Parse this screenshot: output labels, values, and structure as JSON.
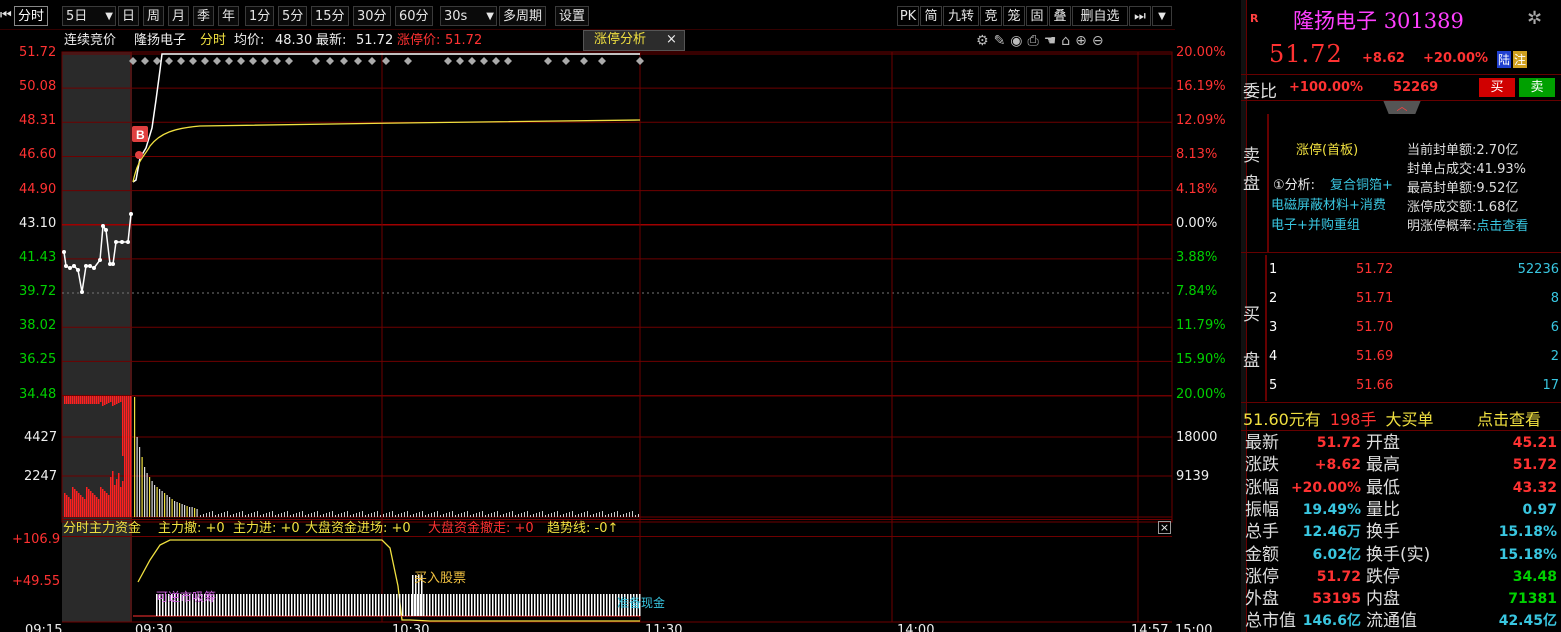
{
  "toolbar": {
    "left": [
      "分时",
      "5日",
      "日",
      "周",
      "月",
      "季",
      "年",
      "1分",
      "5分",
      "15分",
      "30分",
      "60分",
      "30s",
      "多周期",
      "设置"
    ],
    "right": [
      "PK",
      "简",
      "九转",
      "竞",
      "笼",
      "固",
      "叠",
      "删自选"
    ]
  },
  "chart": {
    "info": {
      "auction": "连续竞价",
      "name": "隆扬电子",
      "mode": "分时",
      "avg_label": "均价:",
      "avg": "48.30",
      "latest_label": "最新:",
      "latest": "51.72",
      "limit_label": "涨停价:",
      "limit": "51.72"
    },
    "tab": "涨停分析",
    "price_ticks": [
      "51.72",
      "50.08",
      "48.31",
      "46.60",
      "44.90",
      "43.10",
      "41.43",
      "39.72",
      "38.02",
      "36.25",
      "34.48"
    ],
    "pct_ticks": [
      "20.00%",
      "16.19%",
      "12.09%",
      "8.13%",
      "4.18%",
      "0.00%",
      "3.88%",
      "7.84%",
      "11.79%",
      "15.90%",
      "20.00%"
    ],
    "vol_ticks_left": [
      "4427",
      "2247"
    ],
    "vol_ticks_right": [
      "18000",
      "9139"
    ],
    "time_ticks": [
      "09:15",
      "09:30",
      "10:30",
      "11:30",
      "14:00",
      "14:57",
      "15:00"
    ],
    "buy_marker": "B",
    "fund": {
      "title": "分时主力资金",
      "items": [
        "主力撤: +0",
        "主力进: +0",
        "大盘资金进场: +0",
        "大盘资金撤走: +0",
        "趋势线: -0↑"
      ],
      "ticks": [
        "+106.9",
        "+49.55"
      ],
      "buy_label": "买入股票",
      "bottom_labels": [
        "可逆市吸筹",
        "准备现金"
      ]
    }
  },
  "quote": {
    "code_label": "R",
    "name": "隆扬电子",
    "code": "301389",
    "price": "51.72",
    "change": "+8.62",
    "pct": "+20.00%",
    "tag1": "陆",
    "tag2": "注",
    "weibi_label": "委比",
    "weibi": "+100.00%",
    "weicha": "52269",
    "buy": "买",
    "sell": "卖",
    "sell_label": [
      "卖",
      "盘"
    ],
    "zt": {
      "title": "涨停(首板)",
      "analysis": "①分析:",
      "concepts": [
        "复合铜箔+",
        "电磁屏蔽材料+消费",
        "电子+并购重组"
      ],
      "stats": [
        {
          "k": "当前封单额:",
          "v": "2.70亿"
        },
        {
          "k": "封单占成交:",
          "v": "41.93%"
        },
        {
          "k": "最高封单额:",
          "v": "9.52亿"
        },
        {
          "k": "涨停成交额:",
          "v": "1.68亿"
        },
        {
          "k": "明涨停概率:",
          "v": "点击查看"
        }
      ]
    },
    "buy_label": [
      "买",
      "盘"
    ],
    "bids": [
      {
        "n": "1",
        "p": "51.72",
        "v": "52236"
      },
      {
        "n": "2",
        "p": "51.71",
        "v": "8"
      },
      {
        "n": "3",
        "p": "51.70",
        "v": "6"
      },
      {
        "n": "4",
        "p": "51.69",
        "v": "2"
      },
      {
        "n": "5",
        "p": "51.66",
        "v": "17"
      }
    ],
    "big": {
      "a": "51.60元有",
      "b": "198手",
      "c": "大买单",
      "d": "点击查看"
    },
    "stats": [
      {
        "k1": "最新",
        "v1": "51.72",
        "k2": "开盘",
        "v2": "45.21"
      },
      {
        "k1": "涨跌",
        "v1": "+8.62",
        "k2": "最高",
        "v2": "51.72"
      },
      {
        "k1": "涨幅",
        "v1": "+20.00%",
        "k2": "最低",
        "v2": "43.32"
      },
      {
        "k1": "振幅",
        "v1": "19.49%",
        "k2": "量比",
        "v2": "0.97"
      },
      {
        "k1": "总手",
        "v1": "12.46万",
        "k2": "换手",
        "v2": "15.18%"
      },
      {
        "k1": "金额",
        "v1": "6.02亿",
        "k2": "换手(实)",
        "v2": "15.18%"
      },
      {
        "k1": "涨停",
        "v1": "51.72",
        "k2": "跌停",
        "v2": "34.48"
      },
      {
        "k1": "外盘",
        "v1": "53195",
        "k2": "内盘",
        "v2": "71381"
      },
      {
        "k1": "总市值",
        "v1": "146.6亿",
        "k2": "流通值",
        "v2": "42.45亿"
      }
    ]
  },
  "colors": {
    "up": "#ff3232",
    "down": "#00d000",
    "grid": "#6e0000",
    "yellow": "#f0e040",
    "cyan": "#39c6e0"
  }
}
